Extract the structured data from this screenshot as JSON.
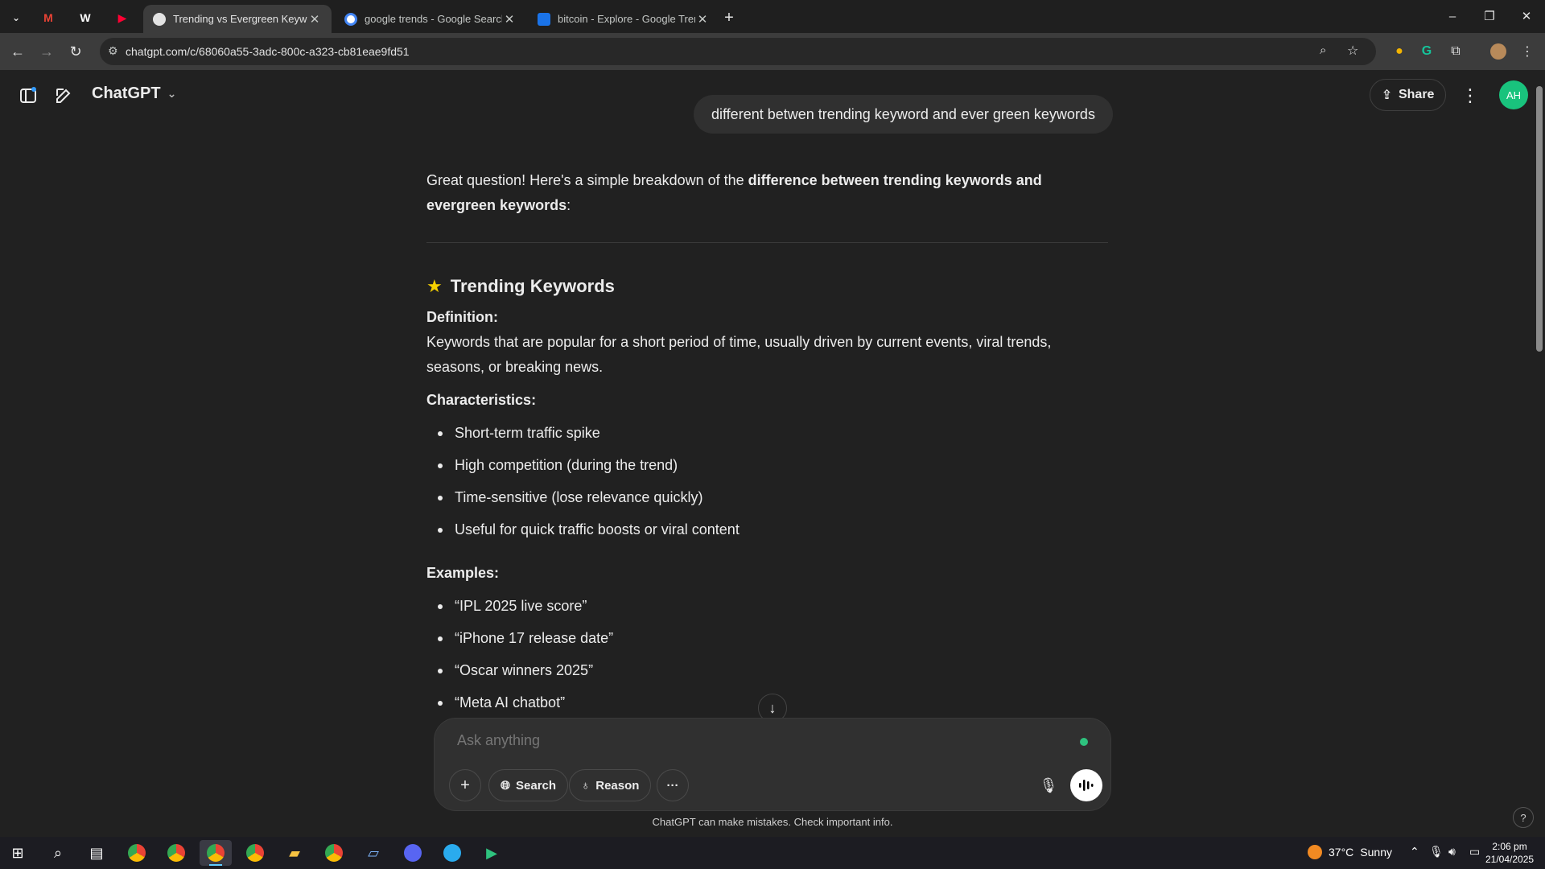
{
  "browser": {
    "pinned_tabs": [
      "M",
      "W",
      "▶"
    ],
    "tabs": [
      {
        "title": "Trending vs Evergreen Keyword",
        "active": true
      },
      {
        "title": "google trends - Google Search",
        "active": false
      },
      {
        "title": "bitcoin - Explore - Google Tren",
        "active": false
      }
    ],
    "new_tab": "+",
    "url": "chatgpt.com/c/68060a55-3adc-800c-a323-cb81eae9fd51",
    "controls": {
      "minimize": "–",
      "restore": "❐",
      "close": "✕"
    }
  },
  "app": {
    "model_name": "ChatGPT",
    "share_label": "Share",
    "avatar_initials": "AH"
  },
  "conversation": {
    "user_message": "different betwen trending keyword and ever green keywords",
    "intro_plain": "Great question! Here's a simple breakdown of the ",
    "intro_bold": "difference between trending keywords and evergreen keywords",
    "intro_end": ":",
    "section_title": "Trending Keywords",
    "definition_label": "Definition:",
    "definition_text": "Keywords that are popular for a short period of time, usually driven by current events, viral trends, seasons, or breaking news.",
    "characteristics_label": "Characteristics:",
    "characteristics": [
      "Short-term traffic spike",
      "High competition (during the trend)",
      "Time-sensitive (lose relevance quickly)",
      "Useful for quick traffic boosts or viral content"
    ],
    "examples_label": "Examples:",
    "examples": [
      "“IPL 2025 live score”",
      "“iPhone 17 release date”",
      "“Oscar winners 2025”",
      "“Meta AI chatbot”"
    ]
  },
  "composer": {
    "placeholder": "Ask anything",
    "search_label": "Search",
    "reason_label": "Reason",
    "more_label": "···"
  },
  "disclaimer": "ChatGPT can make mistakes. Check important info.",
  "help_label": "?",
  "taskbar": {
    "weather_temp": "37°C",
    "weather_desc": "Sunny",
    "time": "2:06 pm",
    "date": "21/04/2025"
  },
  "colors": {
    "background": "#212121",
    "accent_green": "#19c37d",
    "star": "#f5d000"
  }
}
